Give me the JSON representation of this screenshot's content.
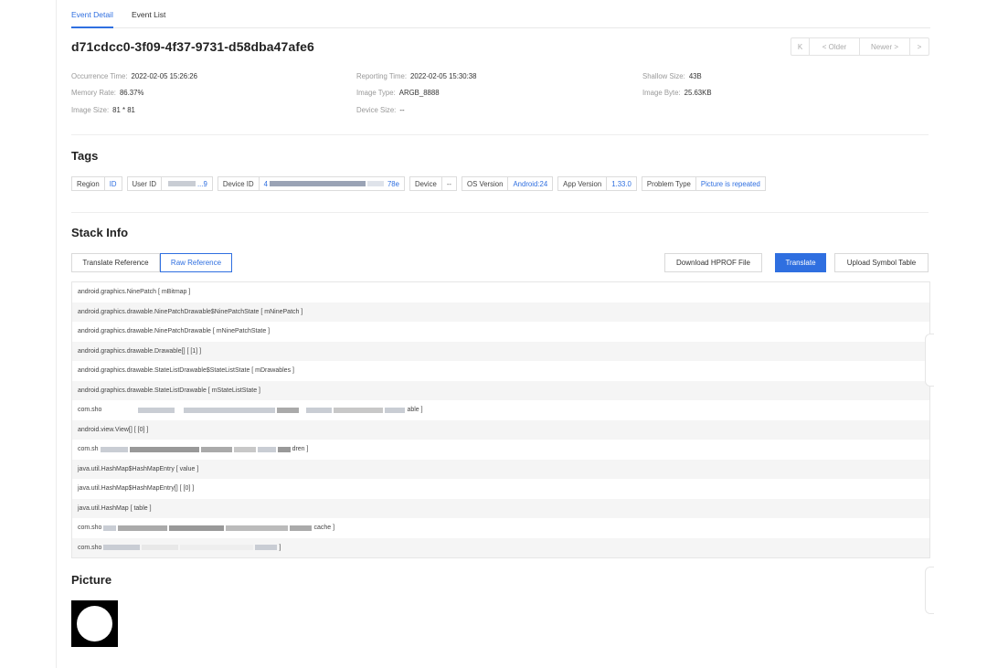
{
  "tabs": [
    {
      "label": "Event Detail"
    },
    {
      "label": "Event List"
    }
  ],
  "event_id": "d71cdcc0-3f09-4f37-9731-d58dba47afe6",
  "pager": {
    "first": "K",
    "older": "< Older",
    "newer": "Newer >",
    "last": ">"
  },
  "meta": {
    "occurrence_time": {
      "label": "Occurrence Time:",
      "value": "2022-02-05 15:26:26"
    },
    "reporting_time": {
      "label": "Reporting Time:",
      "value": "2022-02-05 15:30:38"
    },
    "shallow_size": {
      "label": "Shallow Size:",
      "value": "43B"
    },
    "memory_rate": {
      "label": "Memory Rate:",
      "value": "86.37%"
    },
    "image_type": {
      "label": "Image Type:",
      "value": "ARGB_8888"
    },
    "image_byte": {
      "label": "Image Byte:",
      "value": "25.63KB"
    },
    "image_size": {
      "label": "Image Size:",
      "value": "81 * 81"
    },
    "device_size": {
      "label": "Device Size:",
      "value": "--"
    }
  },
  "sections": {
    "tags": "Tags",
    "stack_info": "Stack Info",
    "picture": "Picture"
  },
  "tags": {
    "region": {
      "key": "Region",
      "value": "ID"
    },
    "user_id": {
      "key": "User ID",
      "value": "...9"
    },
    "device_id": {
      "key": "Device ID",
      "value_start": "4",
      "value_end": "78e"
    },
    "device": {
      "key": "Device",
      "value": "--"
    },
    "os_version": {
      "key": "OS Version",
      "value": "Android:24"
    },
    "app_version": {
      "key": "App Version",
      "value": "1.33.0"
    },
    "problem_type": {
      "key": "Problem Type",
      "value": "Picture is repeated"
    }
  },
  "buttons": {
    "translate_reference": "Translate Reference",
    "raw_reference": "Raw Reference",
    "download_hprof": "Download HPROF File",
    "translate": "Translate",
    "upload_symbol": "Upload Symbol Table"
  },
  "stack_rows": [
    "android.graphics.NinePatch [ mBitmap ]",
    "android.graphics.drawable.NinePatchDrawable$NinePatchState [ mNinePatch ]",
    "android.graphics.drawable.NinePatchDrawable [ mNinePatchState ]",
    "android.graphics.drawable.Drawable[] [ [1] ]",
    "android.graphics.drawable.StateListDrawable$StateListState [ mDrawables ]",
    "android.graphics.drawable.StateListDrawable [ mStateListState ]",
    "com.sho",
    "android.view.View[] [ [0] ]",
    "com.sh",
    "java.util.HashMap$HashMapEntry [ value ]",
    "java.util.HashMap$HashMapEntry[] [ [0] ]",
    "java.util.HashMap [ table ]",
    "com.sho",
    "com.sho"
  ],
  "stack_row_tails": {
    "6": "able ]",
    "8": "dren ]",
    "12": "cache ]",
    "13": "]"
  }
}
